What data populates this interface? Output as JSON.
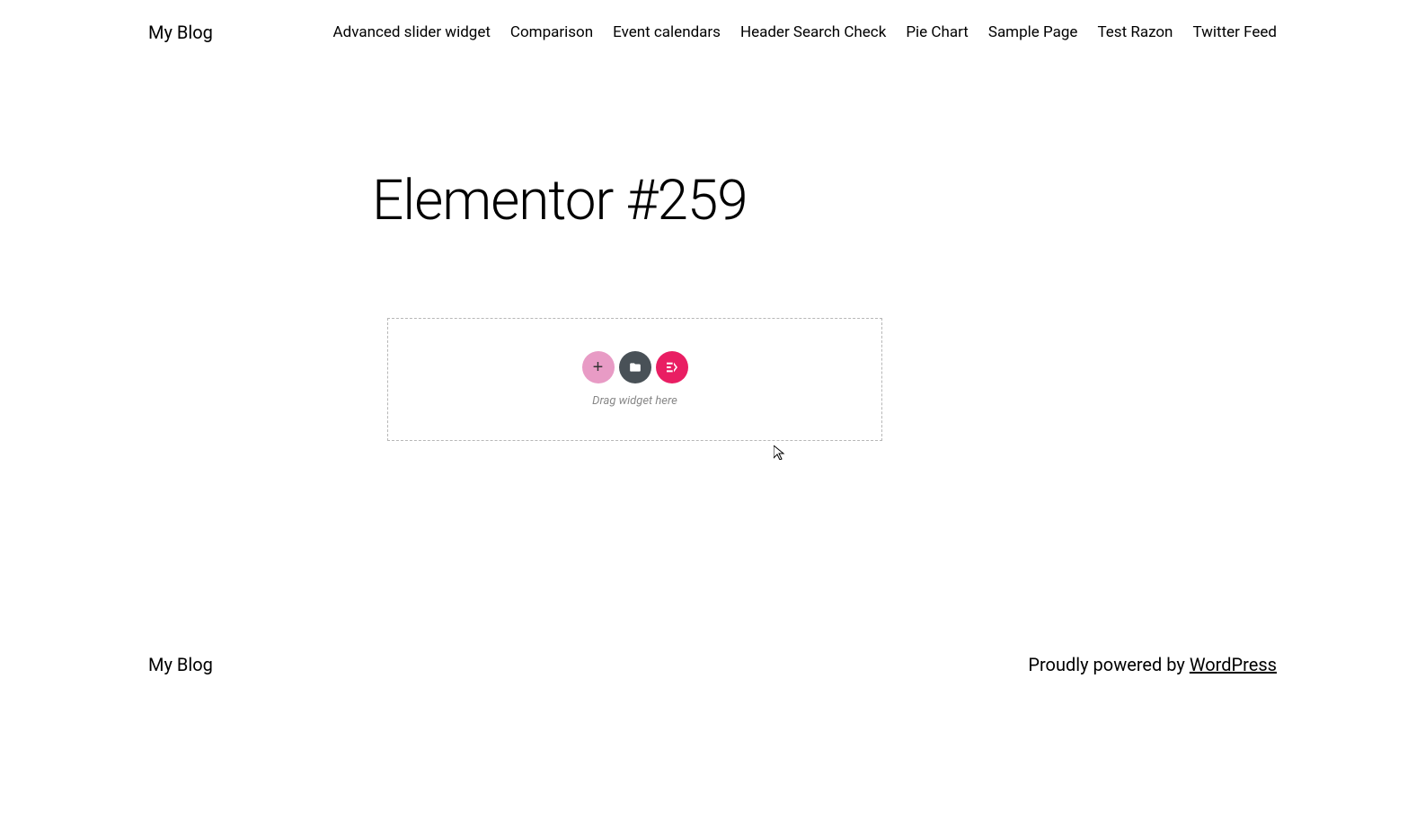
{
  "header": {
    "site_title": "My Blog",
    "nav_items": [
      "Advanced slider widget",
      "Comparison",
      "Event calendars",
      "Header Search Check",
      "Pie Chart",
      "Sample Page",
      "Test Razon",
      "Twitter Feed"
    ]
  },
  "main": {
    "page_title": "Elementor #259"
  },
  "drop_zone": {
    "add_label": "+",
    "elementskit_label": "EK",
    "drag_text": "Drag widget here"
  },
  "footer": {
    "site_title": "My Blog",
    "credit_prefix": "Proudly powered by ",
    "credit_link": "WordPress"
  }
}
